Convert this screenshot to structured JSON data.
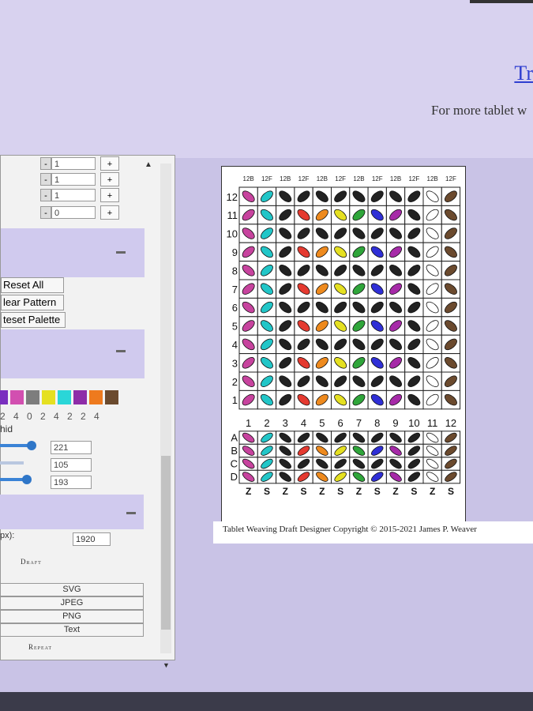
{
  "header": {
    "link_title": "Tr",
    "more_text": "For more tablet w"
  },
  "panel": {
    "steppers": [
      {
        "minus": "-",
        "value": "1",
        "plus": "+"
      },
      {
        "minus": "-",
        "value": "1",
        "plus": "+"
      },
      {
        "minus": "-",
        "value": "1",
        "plus": "+"
      },
      {
        "minus": "-",
        "value": "0",
        "plus": "+"
      }
    ],
    "buttons": {
      "reset_all": "Reset All",
      "clear_pattern": "lear Pattern",
      "reset_palette": "teset Palette"
    },
    "palette_colors": [
      "#7a2fbf",
      "#d24fb0",
      "#7d7d7d",
      "#e5e021",
      "#2ad6d8",
      "#8e2ca8",
      "#ee7a1e",
      "#6b4a2e"
    ],
    "number_row": "2 4 0 2 4 2 2 4",
    "hid_label": "hid",
    "slider_values": [
      "221",
      "105",
      "193"
    ],
    "px_label": "px):",
    "width_value": "1920",
    "draft_heading": "Draft",
    "export_buttons": [
      "SVG",
      "JPEG",
      "PNG",
      "Text"
    ],
    "repeat_heading": "Repeat"
  },
  "draft": {
    "top_labels": [
      "12B",
      "12F",
      "12B",
      "12F",
      "12B",
      "12F",
      "12B",
      "12F",
      "12B",
      "12F",
      "12B",
      "12F"
    ],
    "row_numbers": [
      "12",
      "11",
      "10",
      "9",
      "8",
      "7",
      "6",
      "5",
      "4",
      "3",
      "2",
      "1"
    ],
    "col_numbers": [
      "1",
      "2",
      "3",
      "4",
      "5",
      "6",
      "7",
      "8",
      "9",
      "10",
      "11",
      "12"
    ],
    "hole_labels": [
      "A",
      "B",
      "C",
      "D"
    ],
    "twist_labels": [
      "Z",
      "S",
      "Z",
      "S",
      "Z",
      "S",
      "Z",
      "S",
      "Z",
      "S",
      "Z",
      "S"
    ],
    "main_grid": [
      [
        "#c7439e",
        "#22c6c8",
        "#222",
        "#222",
        "#222",
        "#222",
        "#222",
        "#222",
        "#222",
        "#222",
        "#ffffff",
        "#6b4a2e"
      ],
      [
        "#c7439e",
        "#22c6c8",
        "#222",
        "#e53a30",
        "#ee8a1e",
        "#e5e021",
        "#2fa53a",
        "#2f2fd6",
        "#a62aa8",
        "#222",
        "#ffffff",
        "#6b4a2e"
      ],
      [
        "#c7439e",
        "#22c6c8",
        "#222",
        "#222",
        "#222",
        "#222",
        "#222",
        "#222",
        "#222",
        "#222",
        "#ffffff",
        "#6b4a2e"
      ],
      [
        "#c7439e",
        "#22c6c8",
        "#222",
        "#e53a30",
        "#ee8a1e",
        "#e5e021",
        "#2fa53a",
        "#2f2fd6",
        "#a62aa8",
        "#222",
        "#ffffff",
        "#6b4a2e"
      ],
      [
        "#c7439e",
        "#22c6c8",
        "#222",
        "#222",
        "#222",
        "#222",
        "#222",
        "#222",
        "#222",
        "#222",
        "#ffffff",
        "#6b4a2e"
      ],
      [
        "#c7439e",
        "#22c6c8",
        "#222",
        "#e53a30",
        "#ee8a1e",
        "#e5e021",
        "#2fa53a",
        "#2f2fd6",
        "#a62aa8",
        "#222",
        "#ffffff",
        "#6b4a2e"
      ],
      [
        "#c7439e",
        "#22c6c8",
        "#222",
        "#222",
        "#222",
        "#222",
        "#222",
        "#222",
        "#222",
        "#222",
        "#ffffff",
        "#6b4a2e"
      ],
      [
        "#c7439e",
        "#22c6c8",
        "#222",
        "#e53a30",
        "#ee8a1e",
        "#e5e021",
        "#2fa53a",
        "#2f2fd6",
        "#a62aa8",
        "#222",
        "#ffffff",
        "#6b4a2e"
      ],
      [
        "#c7439e",
        "#22c6c8",
        "#222",
        "#222",
        "#222",
        "#222",
        "#222",
        "#222",
        "#222",
        "#222",
        "#ffffff",
        "#6b4a2e"
      ],
      [
        "#c7439e",
        "#22c6c8",
        "#222",
        "#e53a30",
        "#ee8a1e",
        "#e5e021",
        "#2fa53a",
        "#2f2fd6",
        "#a62aa8",
        "#222",
        "#ffffff",
        "#6b4a2e"
      ],
      [
        "#c7439e",
        "#22c6c8",
        "#222",
        "#222",
        "#222",
        "#222",
        "#222",
        "#222",
        "#222",
        "#222",
        "#ffffff",
        "#6b4a2e"
      ],
      [
        "#c7439e",
        "#22c6c8",
        "#222",
        "#e53a30",
        "#ee8a1e",
        "#e5e021",
        "#2fa53a",
        "#2f2fd6",
        "#a62aa8",
        "#222",
        "#ffffff",
        "#6b4a2e"
      ]
    ],
    "thread_grid": [
      [
        "#c7439e",
        "#22c6c8",
        "#222",
        "#222",
        "#222",
        "#222",
        "#222",
        "#222",
        "#222",
        "#222",
        "#ffffff",
        "#6b4a2e"
      ],
      [
        "#c7439e",
        "#22c6c8",
        "#222",
        "#e53a30",
        "#ee8a1e",
        "#e5e021",
        "#2fa53a",
        "#2f2fd6",
        "#a62aa8",
        "#222",
        "#ffffff",
        "#6b4a2e"
      ],
      [
        "#c7439e",
        "#22c6c8",
        "#222",
        "#222",
        "#222",
        "#222",
        "#222",
        "#222",
        "#222",
        "#222",
        "#ffffff",
        "#6b4a2e"
      ],
      [
        "#c7439e",
        "#22c6c8",
        "#222",
        "#e53a30",
        "#ee8a1e",
        "#e5e021",
        "#2fa53a",
        "#2f2fd6",
        "#a62aa8",
        "#222",
        "#ffffff",
        "#6b4a2e"
      ]
    ]
  },
  "footer": {
    "copyright": "Tablet Weaving Draft Designer Copyright © 2015-2021 James P. Weaver"
  }
}
